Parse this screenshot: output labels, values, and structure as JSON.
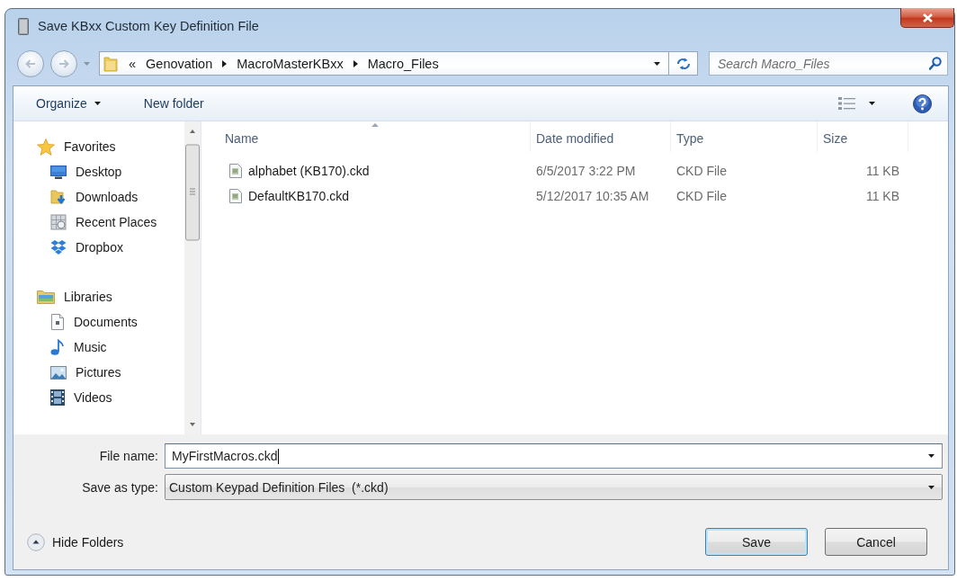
{
  "window": {
    "title": "Save KBxx Custom Key Definition File"
  },
  "navigation": {
    "back": {
      "disabled": true
    },
    "forward": {
      "disabled": true
    }
  },
  "address_bar": {
    "overflow": "«",
    "path": [
      "Genovation",
      "MacroMasterKBxx",
      "Macro_Files"
    ]
  },
  "search": {
    "placeholder": "Search Macro_Files"
  },
  "toolbar": {
    "organize": "Organize",
    "new_folder": "New folder"
  },
  "nav_tree": [
    {
      "label": "Favorites",
      "kind": "favorites",
      "children": [
        {
          "label": "Desktop",
          "kind": "desktop"
        },
        {
          "label": "Downloads",
          "kind": "downloads"
        },
        {
          "label": "Recent Places",
          "kind": "recent"
        },
        {
          "label": "Dropbox",
          "kind": "dropbox"
        }
      ]
    },
    {
      "label": "Libraries",
      "kind": "libraries",
      "children": [
        {
          "label": "Documents",
          "kind": "documents"
        },
        {
          "label": "Music",
          "kind": "music"
        },
        {
          "label": "Pictures",
          "kind": "pictures"
        },
        {
          "label": "Videos",
          "kind": "videos"
        }
      ]
    }
  ],
  "file_list": {
    "columns": [
      {
        "label": "Name",
        "sorted": true
      },
      {
        "label": "Date modified",
        "sorted": false
      },
      {
        "label": "Type",
        "sorted": false
      },
      {
        "label": "Size",
        "sorted": false
      }
    ],
    "rows": [
      {
        "name": "alphabet (KB170).ckd",
        "date_modified": "6/5/2017 3:22 PM",
        "type": "CKD File",
        "size": "11 KB"
      },
      {
        "name": "DefaultKB170.ckd",
        "date_modified": "5/12/2017 10:35 AM",
        "type": "CKD File",
        "size": "11 KB"
      }
    ]
  },
  "file_name": {
    "label": "File name:",
    "value": "MyFirstMacros.ckd",
    "focused": true
  },
  "save_as_type": {
    "label": "Save as type:",
    "value": "Custom Keypad Definition Files  (*.ckd)"
  },
  "hide_folders": "Hide Folders",
  "buttons": [
    {
      "label": "Save",
      "default": true
    },
    {
      "label": "Cancel",
      "default": false
    }
  ]
}
